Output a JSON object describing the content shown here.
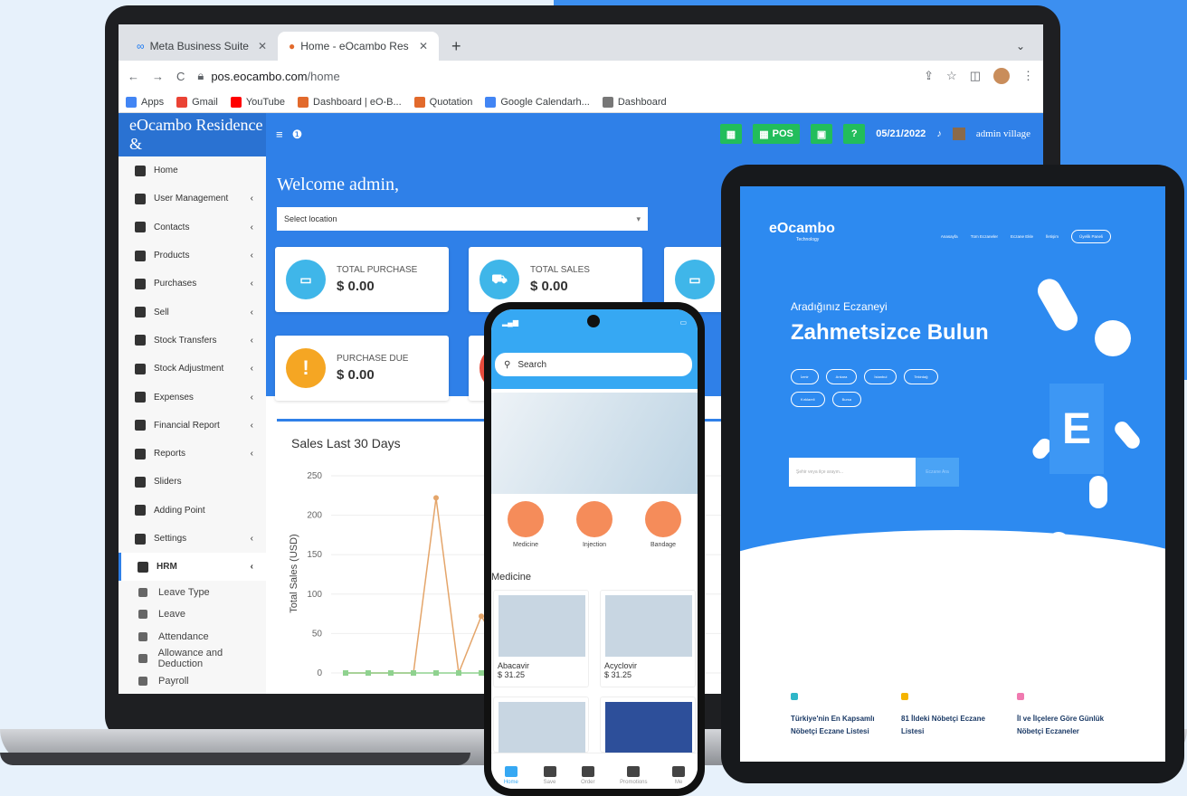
{
  "browser": {
    "tabs": [
      {
        "label": "Meta Business Suite",
        "active": false
      },
      {
        "label": "Home - eOcambo Residence &",
        "active": true
      }
    ],
    "url_host": "pos.eocambo.com",
    "url_path": "/home",
    "bookmarks": [
      "Apps",
      "Gmail",
      "YouTube",
      "Dashboard | eO-B...",
      "Quotation",
      "Google Calendarh...",
      "Dashboard"
    ]
  },
  "app": {
    "brand": "eOcambo Residence &",
    "topbar": {
      "pos_label": "POS",
      "date": "05/21/2022",
      "user": "admin village"
    },
    "sidebar": {
      "items": [
        {
          "label": "Home",
          "chevron": false
        },
        {
          "label": "User Management",
          "chevron": true
        },
        {
          "label": "Contacts",
          "chevron": true
        },
        {
          "label": "Products",
          "chevron": true
        },
        {
          "label": "Purchases",
          "chevron": true
        },
        {
          "label": "Sell",
          "chevron": true
        },
        {
          "label": "Stock Transfers",
          "chevron": true
        },
        {
          "label": "Stock Adjustment",
          "chevron": true
        },
        {
          "label": "Expenses",
          "chevron": true
        },
        {
          "label": "Financial Report",
          "chevron": true
        },
        {
          "label": "Reports",
          "chevron": true
        },
        {
          "label": "Sliders",
          "chevron": false
        },
        {
          "label": "Adding Point",
          "chevron": false
        },
        {
          "label": "Settings",
          "chevron": true
        },
        {
          "label": "HRM",
          "chevron": true
        }
      ],
      "hrm_sub": [
        "Leave Type",
        "Leave",
        "Attendance",
        "Allowance and Deduction",
        "Payroll"
      ]
    },
    "welcome": "Welcome admin,",
    "location_placeholder": "Select location",
    "cards": [
      {
        "label": "TOTAL PURCHASE",
        "value": "$ 0.00",
        "color": "#3fb6e9"
      },
      {
        "label": "TOTAL SALES",
        "value": "$ 0.00",
        "color": "#3fb6e9"
      },
      {
        "label": "PURCHASE DUE",
        "value": "$ 0.00",
        "color": "#f5a623"
      }
    ],
    "chart": {
      "title": "Sales Last 30 Days",
      "ylabel": "Total Sales (USD)"
    }
  },
  "chart_data": {
    "type": "line",
    "title": "Sales Last 30 Days",
    "ylabel": "Total Sales (USD)",
    "ylim": [
      0,
      250
    ],
    "yticks": [
      0,
      50,
      100,
      150,
      200,
      250
    ],
    "series": [
      {
        "values": [
          0,
          0,
          0,
          0,
          222,
          0,
          72,
          25
        ],
        "color": "#e4a56a"
      },
      {
        "values": [
          0,
          0,
          0,
          0,
          0,
          0,
          0,
          0
        ],
        "color": "#8fd28f"
      }
    ]
  },
  "phone": {
    "search_placeholder": "Search",
    "categories": [
      "Medicine",
      "Injection",
      "Bandage"
    ],
    "section": "Medicine",
    "products": [
      {
        "name": "Abacavir",
        "price": "$ 31.25"
      },
      {
        "name": "Acyclovir",
        "price": "$ 31.25"
      }
    ],
    "nav": [
      "Home",
      "Save",
      "Order",
      "Promotions",
      "Me"
    ]
  },
  "tablet": {
    "logo": "eOcambo",
    "logo_sub": "Technology",
    "nav": [
      "Anasayfa",
      "Tüm Eczaneler",
      "Eczane Ekle",
      "İletişim",
      "Üyelik Paneli"
    ],
    "subtitle": "Aradığınız Eczaneyi",
    "headline": "Zahmetsizce Bulun",
    "chips": [
      "İzmir",
      "Ankara",
      "İstanbul",
      "Tekirdağ",
      "Kırklareli",
      "Bursa"
    ],
    "search_placeholder": "Şehir veya ilçe arayın...",
    "search_button": "Eczane Ara",
    "features": [
      {
        "title": "Türkiye'nin En Kapsamlı Nöbetçi Eczane Listesi",
        "color": "#2fb6c8"
      },
      {
        "title": "81 İldeki Nöbetçi Eczane Listesi",
        "color": "#f5b400"
      },
      {
        "title": "İl ve İlçelere Göre Günlük Nöbetçi Eczaneler",
        "color": "#f07ab0"
      }
    ]
  }
}
